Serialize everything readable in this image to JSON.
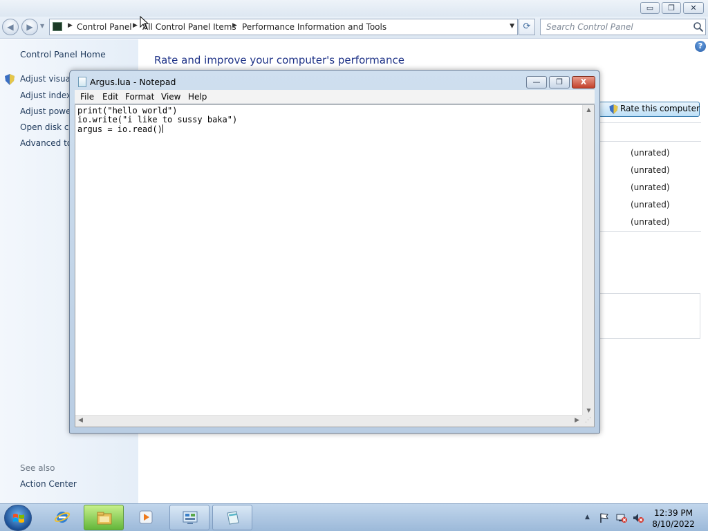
{
  "explorer": {
    "window_controls": {
      "minimize": "▭",
      "restore": "❐",
      "close": "✕"
    },
    "breadcrumb": [
      "Control Panel",
      "All Control Panel Items",
      "Performance Information and Tools"
    ],
    "search_placeholder": "Search Control Panel",
    "left_pane": {
      "home_label": "Control Panel Home",
      "links": [
        "Adjust visual",
        "Adjust indexin",
        "Adjust power",
        "Open disk cle",
        "Advanced too"
      ],
      "see_also_label": "See also",
      "see_also_links": [
        "Action Center"
      ]
    },
    "main": {
      "heading": "Rate and improve your computer's performance",
      "rate_button": "Rate this computer",
      "scores": [
        "(unrated)",
        "(unrated)",
        "(unrated)",
        "(unrated)",
        "(unrated)"
      ]
    }
  },
  "notepad": {
    "title": "Argus.lua - Notepad",
    "menu": [
      "File",
      "Edit",
      "Format",
      "View",
      "Help"
    ],
    "lines": [
      "print(\"hello world\")",
      "io.write(\"i like to sussy baka\")",
      "argus = io.read()"
    ],
    "window_controls": {
      "minimize": "—",
      "restore": "❐",
      "close": "X"
    }
  },
  "taskbar": {
    "pinned": [
      "internet-explorer-icon",
      "file-explorer-icon",
      "media-player-icon",
      "control-panel-icon",
      "notepad-icon"
    ],
    "clock": {
      "time": "12:39 PM",
      "date": "8/10/2022"
    }
  },
  "colors": {
    "heading": "#1e3287",
    "link": "#1e395b",
    "taskbar": "#b2cbe6"
  }
}
